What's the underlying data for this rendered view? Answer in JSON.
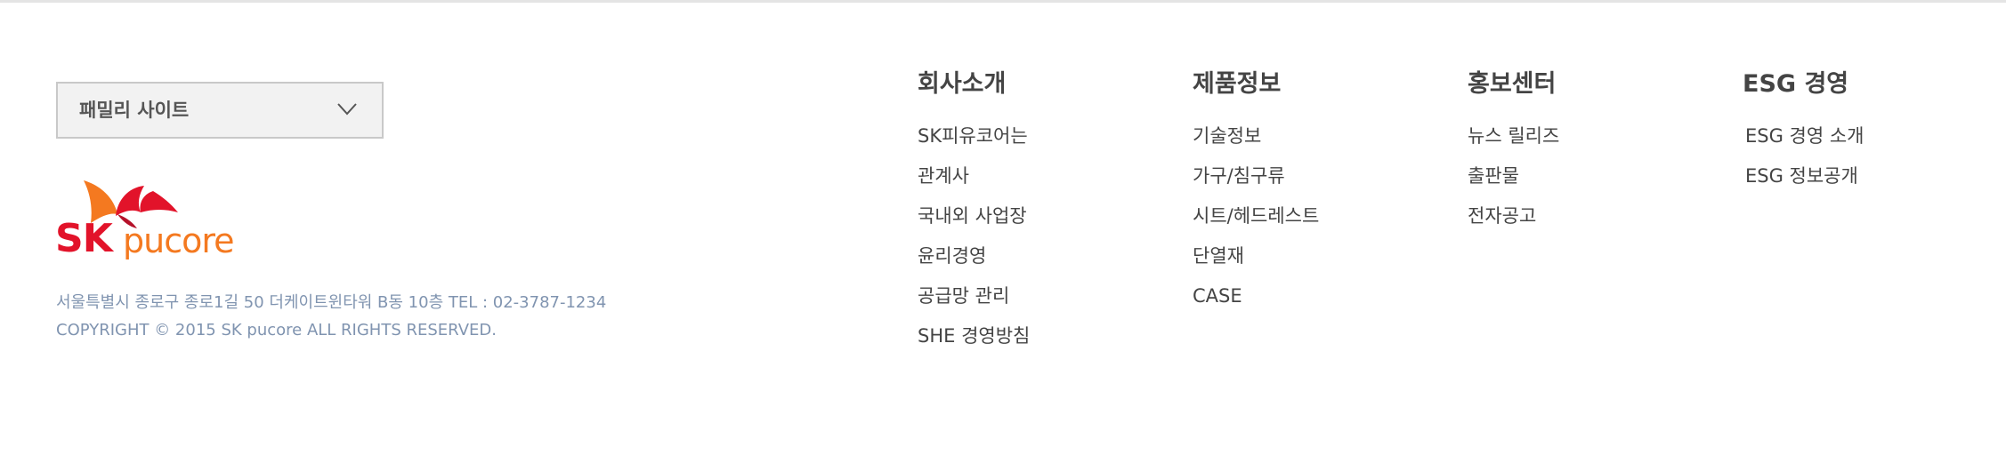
{
  "family_site": {
    "label": "패밀리 사이트"
  },
  "logo": {
    "sk": "SK",
    "pucore": "pucore",
    "colors": {
      "sk": "#e2132a",
      "pucore": "#f47920"
    }
  },
  "address": {
    "line1": "서울특별시 종로구 종로1길 50 더케이트윈타워 B동 10층 TEL : 02-3787-1234",
    "line2": "COPYRIGHT © 2015 SK pucore ALL RIGHTS RESERVED."
  },
  "menu": {
    "company": {
      "title": "회사소개",
      "items": [
        "SK피유코어는",
        "관계사",
        "국내외 사업장",
        "윤리경영",
        "공급망 관리",
        "SHE 경영방침"
      ]
    },
    "products": {
      "title": "제품정보",
      "items": [
        "기술정보",
        "가구/침구류",
        "시트/헤드레스트",
        "단열재",
        "CASE"
      ]
    },
    "pr": {
      "title": "홍보센터",
      "items": [
        "뉴스 릴리즈",
        "출판물",
        "전자공고"
      ]
    },
    "esg": {
      "title": "ESG 경영",
      "items": [
        "ESG 경영 소개",
        "ESG 정보공개"
      ]
    }
  }
}
